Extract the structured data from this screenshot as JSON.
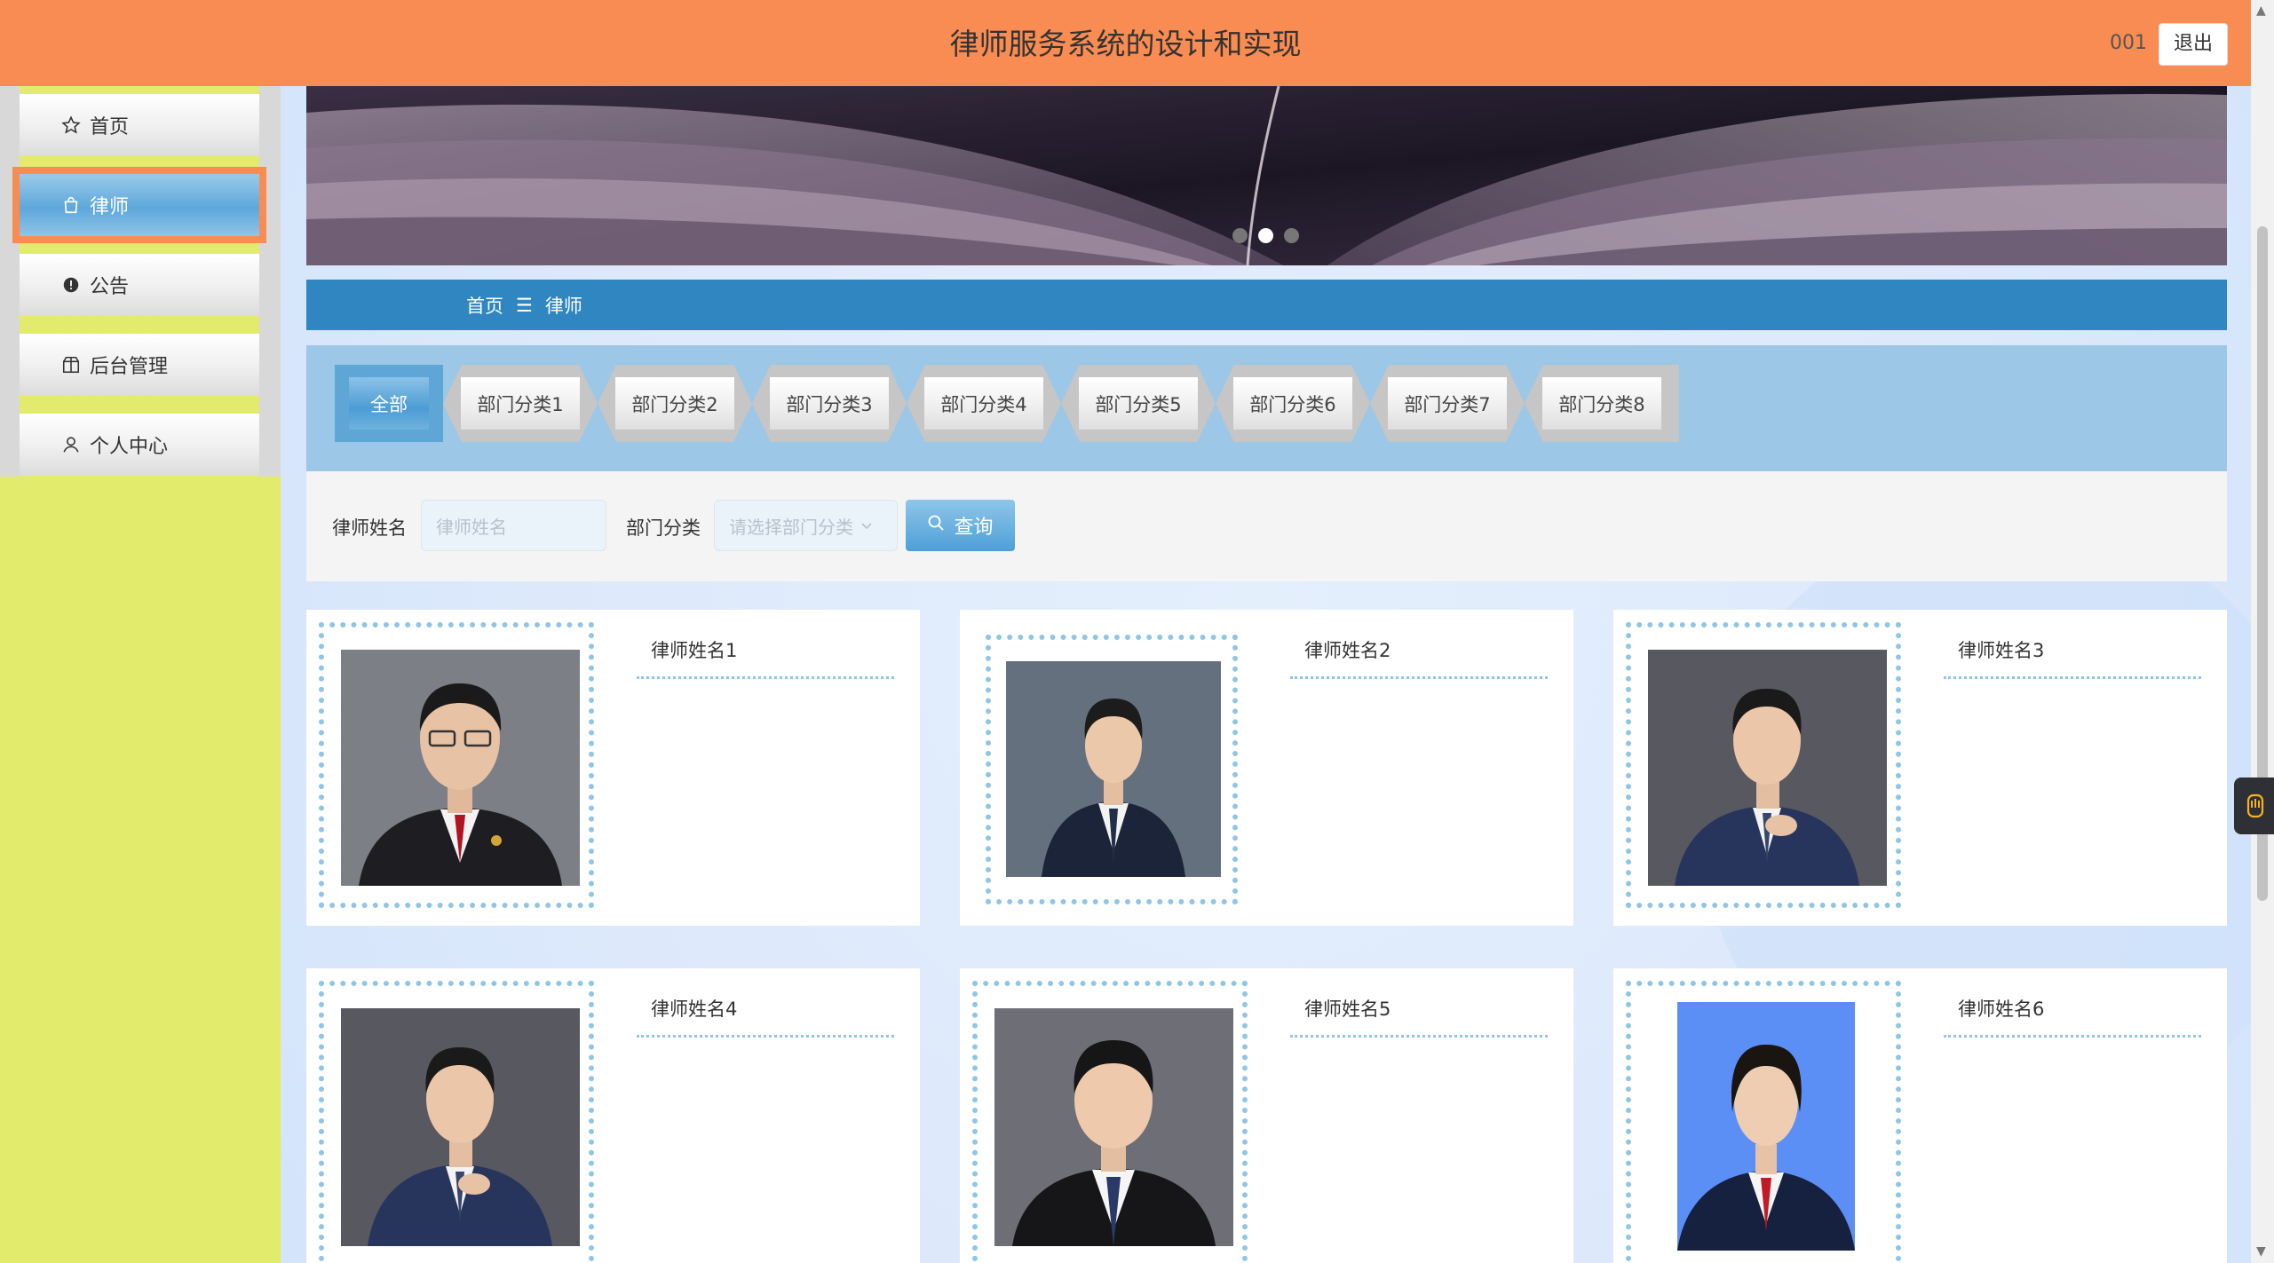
{
  "header": {
    "title": "律师服务系统的设计和实现",
    "user": "001",
    "logout_label": "退出"
  },
  "sidebar": {
    "items": [
      {
        "label": "首页",
        "icon": "star-icon"
      },
      {
        "label": "律师",
        "icon": "bag-icon",
        "active": true
      },
      {
        "label": "公告",
        "icon": "alert-icon"
      },
      {
        "label": "后台管理",
        "icon": "box-icon"
      },
      {
        "label": "个人中心",
        "icon": "person-icon"
      }
    ]
  },
  "breadcrumb": {
    "home": "首页",
    "separator": "☰",
    "current": "律师"
  },
  "tabs": [
    "全部",
    "部门分类1",
    "部门分类2",
    "部门分类3",
    "部门分类4",
    "部门分类5",
    "部门分类6",
    "部门分类7",
    "部门分类8"
  ],
  "search": {
    "name_label": "律师姓名",
    "name_placeholder": "律师姓名",
    "dept_label": "部门分类",
    "dept_placeholder": "请选择部门分类",
    "button_label": "查询"
  },
  "lawyers": [
    {
      "name": "律师姓名1"
    },
    {
      "name": "律师姓名2"
    },
    {
      "name": "律师姓名3"
    },
    {
      "name": "律师姓名4"
    },
    {
      "name": "律师姓名5"
    },
    {
      "name": "律师姓名6"
    }
  ],
  "banner": {
    "active_dot": 2,
    "dot_count": 3
  },
  "colors": {
    "header": "#f98c52",
    "sidebar": "#e2eb6b",
    "breadcrumb": "#2f86c1",
    "tabs_panel": "#9cc7e6",
    "accent_dots": "#8fc6e6"
  }
}
